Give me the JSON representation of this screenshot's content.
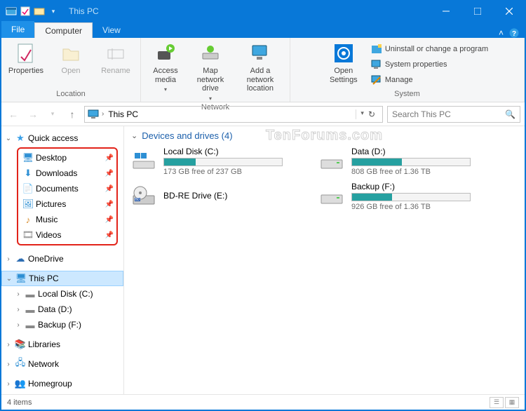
{
  "window": {
    "title": "This PC"
  },
  "tabs": {
    "file": "File",
    "computer": "Computer",
    "view": "View"
  },
  "ribbon": {
    "location": {
      "label": "Location",
      "properties": "Properties",
      "open": "Open",
      "rename": "Rename"
    },
    "network": {
      "label": "Network",
      "access_media": "Access media",
      "map_drive": "Map network drive",
      "add_location": "Add a network location"
    },
    "system": {
      "label": "System",
      "open_settings": "Open Settings",
      "uninstall": "Uninstall or change a program",
      "sys_props": "System properties",
      "manage": "Manage"
    }
  },
  "address": {
    "location": "This PC"
  },
  "search": {
    "placeholder": "Search This PC"
  },
  "sidebar": {
    "quick_access": "Quick access",
    "qa_items": [
      {
        "label": "Desktop"
      },
      {
        "label": "Downloads"
      },
      {
        "label": "Documents"
      },
      {
        "label": "Pictures"
      },
      {
        "label": "Music"
      },
      {
        "label": "Videos"
      }
    ],
    "onedrive": "OneDrive",
    "this_pc": "This PC",
    "pc_items": [
      {
        "label": "Local Disk (C:)"
      },
      {
        "label": "Data (D:)"
      },
      {
        "label": "Backup (F:)"
      }
    ],
    "libraries": "Libraries",
    "network": "Network",
    "homegroup": "Homegroup"
  },
  "main": {
    "section_title": "Devices and drives (4)",
    "drives": [
      {
        "name": "Local Disk (C:)",
        "free": "173 GB free of 237 GB",
        "fill_pct": 27,
        "fill_color": "#26a0a0"
      },
      {
        "name": "Data (D:)",
        "free": "808 GB free of 1.36 TB",
        "fill_pct": 42,
        "fill_color": "#26a0a0"
      },
      {
        "name": "BD-RE Drive (E:)",
        "free": "",
        "fill_pct": -1,
        "fill_color": ""
      },
      {
        "name": "Backup (F:)",
        "free": "926 GB free of 1.36 TB",
        "fill_pct": 34,
        "fill_color": "#26a0a0"
      }
    ]
  },
  "status": {
    "count": "4 items"
  },
  "watermark": "TenForums.com"
}
